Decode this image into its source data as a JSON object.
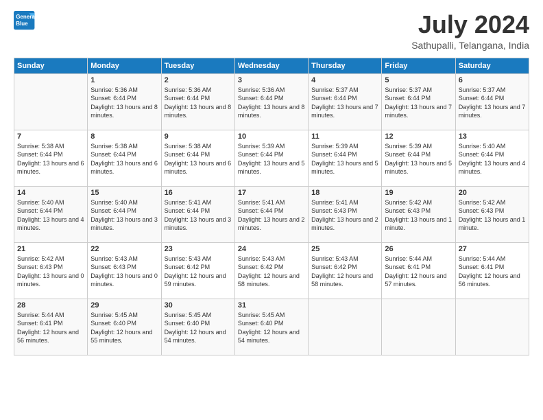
{
  "logo": {
    "text_general": "General",
    "text_blue": "Blue"
  },
  "header": {
    "month": "July 2024",
    "location": "Sathupalli, Telangana, India"
  },
  "weekdays": [
    "Sunday",
    "Monday",
    "Tuesday",
    "Wednesday",
    "Thursday",
    "Friday",
    "Saturday"
  ],
  "weeks": [
    [
      {
        "day": "",
        "sunrise": "",
        "sunset": "",
        "daylight": ""
      },
      {
        "day": "1",
        "sunrise": "Sunrise: 5:36 AM",
        "sunset": "Sunset: 6:44 PM",
        "daylight": "Daylight: 13 hours and 8 minutes."
      },
      {
        "day": "2",
        "sunrise": "Sunrise: 5:36 AM",
        "sunset": "Sunset: 6:44 PM",
        "daylight": "Daylight: 13 hours and 8 minutes."
      },
      {
        "day": "3",
        "sunrise": "Sunrise: 5:36 AM",
        "sunset": "Sunset: 6:44 PM",
        "daylight": "Daylight: 13 hours and 8 minutes."
      },
      {
        "day": "4",
        "sunrise": "Sunrise: 5:37 AM",
        "sunset": "Sunset: 6:44 PM",
        "daylight": "Daylight: 13 hours and 7 minutes."
      },
      {
        "day": "5",
        "sunrise": "Sunrise: 5:37 AM",
        "sunset": "Sunset: 6:44 PM",
        "daylight": "Daylight: 13 hours and 7 minutes."
      },
      {
        "day": "6",
        "sunrise": "Sunrise: 5:37 AM",
        "sunset": "Sunset: 6:44 PM",
        "daylight": "Daylight: 13 hours and 7 minutes."
      }
    ],
    [
      {
        "day": "7",
        "sunrise": "Sunrise: 5:38 AM",
        "sunset": "Sunset: 6:44 PM",
        "daylight": "Daylight: 13 hours and 6 minutes."
      },
      {
        "day": "8",
        "sunrise": "Sunrise: 5:38 AM",
        "sunset": "Sunset: 6:44 PM",
        "daylight": "Daylight: 13 hours and 6 minutes."
      },
      {
        "day": "9",
        "sunrise": "Sunrise: 5:38 AM",
        "sunset": "Sunset: 6:44 PM",
        "daylight": "Daylight: 13 hours and 6 minutes."
      },
      {
        "day": "10",
        "sunrise": "Sunrise: 5:39 AM",
        "sunset": "Sunset: 6:44 PM",
        "daylight": "Daylight: 13 hours and 5 minutes."
      },
      {
        "day": "11",
        "sunrise": "Sunrise: 5:39 AM",
        "sunset": "Sunset: 6:44 PM",
        "daylight": "Daylight: 13 hours and 5 minutes."
      },
      {
        "day": "12",
        "sunrise": "Sunrise: 5:39 AM",
        "sunset": "Sunset: 6:44 PM",
        "daylight": "Daylight: 13 hours and 5 minutes."
      },
      {
        "day": "13",
        "sunrise": "Sunrise: 5:40 AM",
        "sunset": "Sunset: 6:44 PM",
        "daylight": "Daylight: 13 hours and 4 minutes."
      }
    ],
    [
      {
        "day": "14",
        "sunrise": "Sunrise: 5:40 AM",
        "sunset": "Sunset: 6:44 PM",
        "daylight": "Daylight: 13 hours and 4 minutes."
      },
      {
        "day": "15",
        "sunrise": "Sunrise: 5:40 AM",
        "sunset": "Sunset: 6:44 PM",
        "daylight": "Daylight: 13 hours and 3 minutes."
      },
      {
        "day": "16",
        "sunrise": "Sunrise: 5:41 AM",
        "sunset": "Sunset: 6:44 PM",
        "daylight": "Daylight: 13 hours and 3 minutes."
      },
      {
        "day": "17",
        "sunrise": "Sunrise: 5:41 AM",
        "sunset": "Sunset: 6:44 PM",
        "daylight": "Daylight: 13 hours and 2 minutes."
      },
      {
        "day": "18",
        "sunrise": "Sunrise: 5:41 AM",
        "sunset": "Sunset: 6:43 PM",
        "daylight": "Daylight: 13 hours and 2 minutes."
      },
      {
        "day": "19",
        "sunrise": "Sunrise: 5:42 AM",
        "sunset": "Sunset: 6:43 PM",
        "daylight": "Daylight: 13 hours and 1 minute."
      },
      {
        "day": "20",
        "sunrise": "Sunrise: 5:42 AM",
        "sunset": "Sunset: 6:43 PM",
        "daylight": "Daylight: 13 hours and 1 minute."
      }
    ],
    [
      {
        "day": "21",
        "sunrise": "Sunrise: 5:42 AM",
        "sunset": "Sunset: 6:43 PM",
        "daylight": "Daylight: 13 hours and 0 minutes."
      },
      {
        "day": "22",
        "sunrise": "Sunrise: 5:43 AM",
        "sunset": "Sunset: 6:43 PM",
        "daylight": "Daylight: 13 hours and 0 minutes."
      },
      {
        "day": "23",
        "sunrise": "Sunrise: 5:43 AM",
        "sunset": "Sunset: 6:42 PM",
        "daylight": "Daylight: 12 hours and 59 minutes."
      },
      {
        "day": "24",
        "sunrise": "Sunrise: 5:43 AM",
        "sunset": "Sunset: 6:42 PM",
        "daylight": "Daylight: 12 hours and 58 minutes."
      },
      {
        "day": "25",
        "sunrise": "Sunrise: 5:43 AM",
        "sunset": "Sunset: 6:42 PM",
        "daylight": "Daylight: 12 hours and 58 minutes."
      },
      {
        "day": "26",
        "sunrise": "Sunrise: 5:44 AM",
        "sunset": "Sunset: 6:41 PM",
        "daylight": "Daylight: 12 hours and 57 minutes."
      },
      {
        "day": "27",
        "sunrise": "Sunrise: 5:44 AM",
        "sunset": "Sunset: 6:41 PM",
        "daylight": "Daylight: 12 hours and 56 minutes."
      }
    ],
    [
      {
        "day": "28",
        "sunrise": "Sunrise: 5:44 AM",
        "sunset": "Sunset: 6:41 PM",
        "daylight": "Daylight: 12 hours and 56 minutes."
      },
      {
        "day": "29",
        "sunrise": "Sunrise: 5:45 AM",
        "sunset": "Sunset: 6:40 PM",
        "daylight": "Daylight: 12 hours and 55 minutes."
      },
      {
        "day": "30",
        "sunrise": "Sunrise: 5:45 AM",
        "sunset": "Sunset: 6:40 PM",
        "daylight": "Daylight: 12 hours and 54 minutes."
      },
      {
        "day": "31",
        "sunrise": "Sunrise: 5:45 AM",
        "sunset": "Sunset: 6:40 PM",
        "daylight": "Daylight: 12 hours and 54 minutes."
      },
      {
        "day": "",
        "sunrise": "",
        "sunset": "",
        "daylight": ""
      },
      {
        "day": "",
        "sunrise": "",
        "sunset": "",
        "daylight": ""
      },
      {
        "day": "",
        "sunrise": "",
        "sunset": "",
        "daylight": ""
      }
    ]
  ]
}
